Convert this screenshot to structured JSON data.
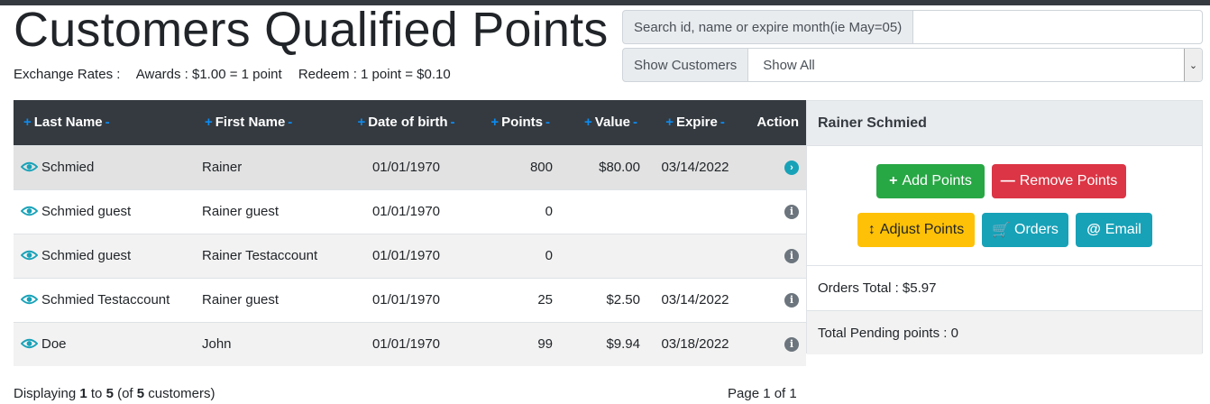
{
  "page": {
    "title": "Customers Qualified Points",
    "rates_label": "Exchange Rates :",
    "awards": "Awards : $1.00 = 1 point",
    "redeem": "Redeem : 1 point = $0.10"
  },
  "search": {
    "label": "Search id, name or expire month(ie May=05)",
    "value": ""
  },
  "filter": {
    "label": "Show Customers",
    "selected": "Show All"
  },
  "table": {
    "sort_plus": "+",
    "sort_minus": "-",
    "headers": {
      "last_name": "Last Name",
      "first_name": "First Name",
      "dob": "Date of birth",
      "points": "Points",
      "value": "Value",
      "expire": "Expire",
      "action": "Action"
    },
    "rows": [
      {
        "last": "Schmied",
        "first": "Rainer",
        "dob": "01/01/1970",
        "points": "800",
        "value": "$80.00",
        "expire": "03/14/2022"
      },
      {
        "last": "Schmied guest",
        "first": "Rainer guest",
        "dob": "01/01/1970",
        "points": "0",
        "value": "",
        "expire": ""
      },
      {
        "last": "Schmied guest",
        "first": "Rainer Testaccount",
        "dob": "01/01/1970",
        "points": "0",
        "value": "",
        "expire": ""
      },
      {
        "last": "Schmied Testaccount",
        "first": "Rainer guest",
        "dob": "01/01/1970",
        "points": "25",
        "value": "$2.50",
        "expire": "03/14/2022"
      },
      {
        "last": "Doe",
        "first": "John",
        "dob": "01/01/1970",
        "points": "99",
        "value": "$9.94",
        "expire": "03/18/2022"
      }
    ]
  },
  "panel": {
    "customer_name": "Rainer Schmied",
    "add_points": "Add Points",
    "remove_points": "Remove Points",
    "adjust_points": "Adjust Points",
    "orders": "Orders",
    "email": "Email",
    "orders_total": "Orders Total : $5.97",
    "pending_points": "Total Pending points : 0"
  },
  "footer": {
    "displaying": "Displaying",
    "from": "1",
    "to_word": "to",
    "to": "5",
    "of_open": "(of",
    "total": "5",
    "customers_close": "customers)",
    "page": "Page 1 of 1"
  },
  "colors": {
    "header_dark": "#343a40",
    "sort_blue": "#0d8bf0",
    "eye_teal": "#17a2b8",
    "add_green": "#28a745",
    "remove_red": "#dc3545",
    "adjust_yellow": "#ffc107",
    "cyan": "#17a2b8"
  }
}
